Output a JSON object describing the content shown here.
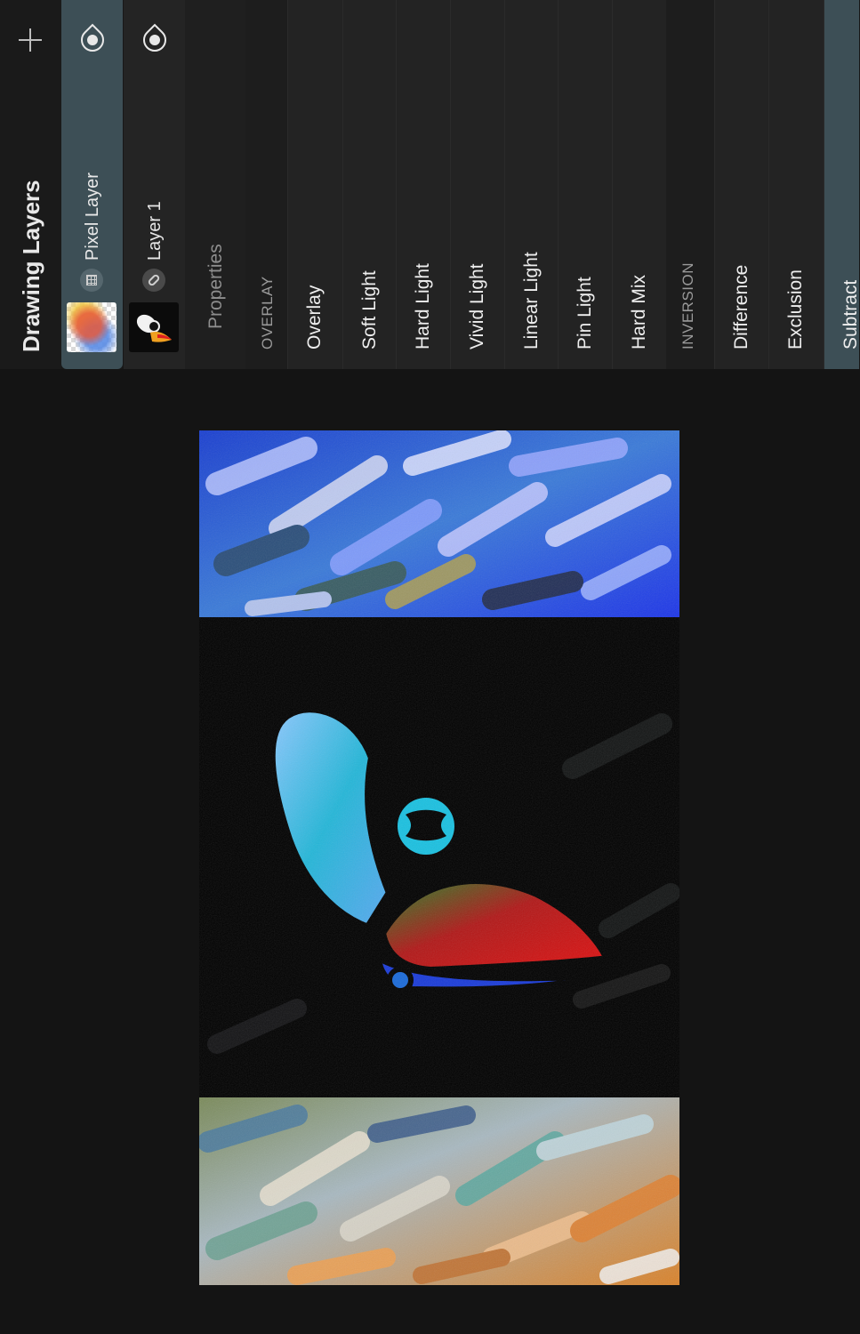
{
  "panel": {
    "title": "Drawing Layers",
    "add_icon": "plus-icon"
  },
  "layers": [
    {
      "name": "Pixel Layer",
      "type_icon": "pixel-grid-icon",
      "visibility_icon": "eye-icon",
      "selected": true
    },
    {
      "name": "Layer 1",
      "type_icon": "link-icon",
      "visibility_icon": "eye-icon",
      "selected": false
    }
  ],
  "properties": {
    "label": "Properties",
    "back_icon": "chevron-left-icon"
  },
  "blend_modes": [
    {
      "label": "OVERLAY",
      "kind": "section"
    },
    {
      "label": "Overlay",
      "kind": "mode"
    },
    {
      "label": "Soft Light",
      "kind": "mode"
    },
    {
      "label": "Hard Light",
      "kind": "mode"
    },
    {
      "label": "Vivid Light",
      "kind": "mode"
    },
    {
      "label": "Linear Light",
      "kind": "mode"
    },
    {
      "label": "Pin Light",
      "kind": "mode"
    },
    {
      "label": "Hard Mix",
      "kind": "mode"
    },
    {
      "label": "INVERSION",
      "kind": "section"
    },
    {
      "label": "Difference",
      "kind": "mode"
    },
    {
      "label": "Exclusion",
      "kind": "mode"
    },
    {
      "label": "Subtract",
      "kind": "mode",
      "selected": true
    }
  ],
  "colors": {
    "selected": "#3d4f56",
    "background": "#141414"
  }
}
